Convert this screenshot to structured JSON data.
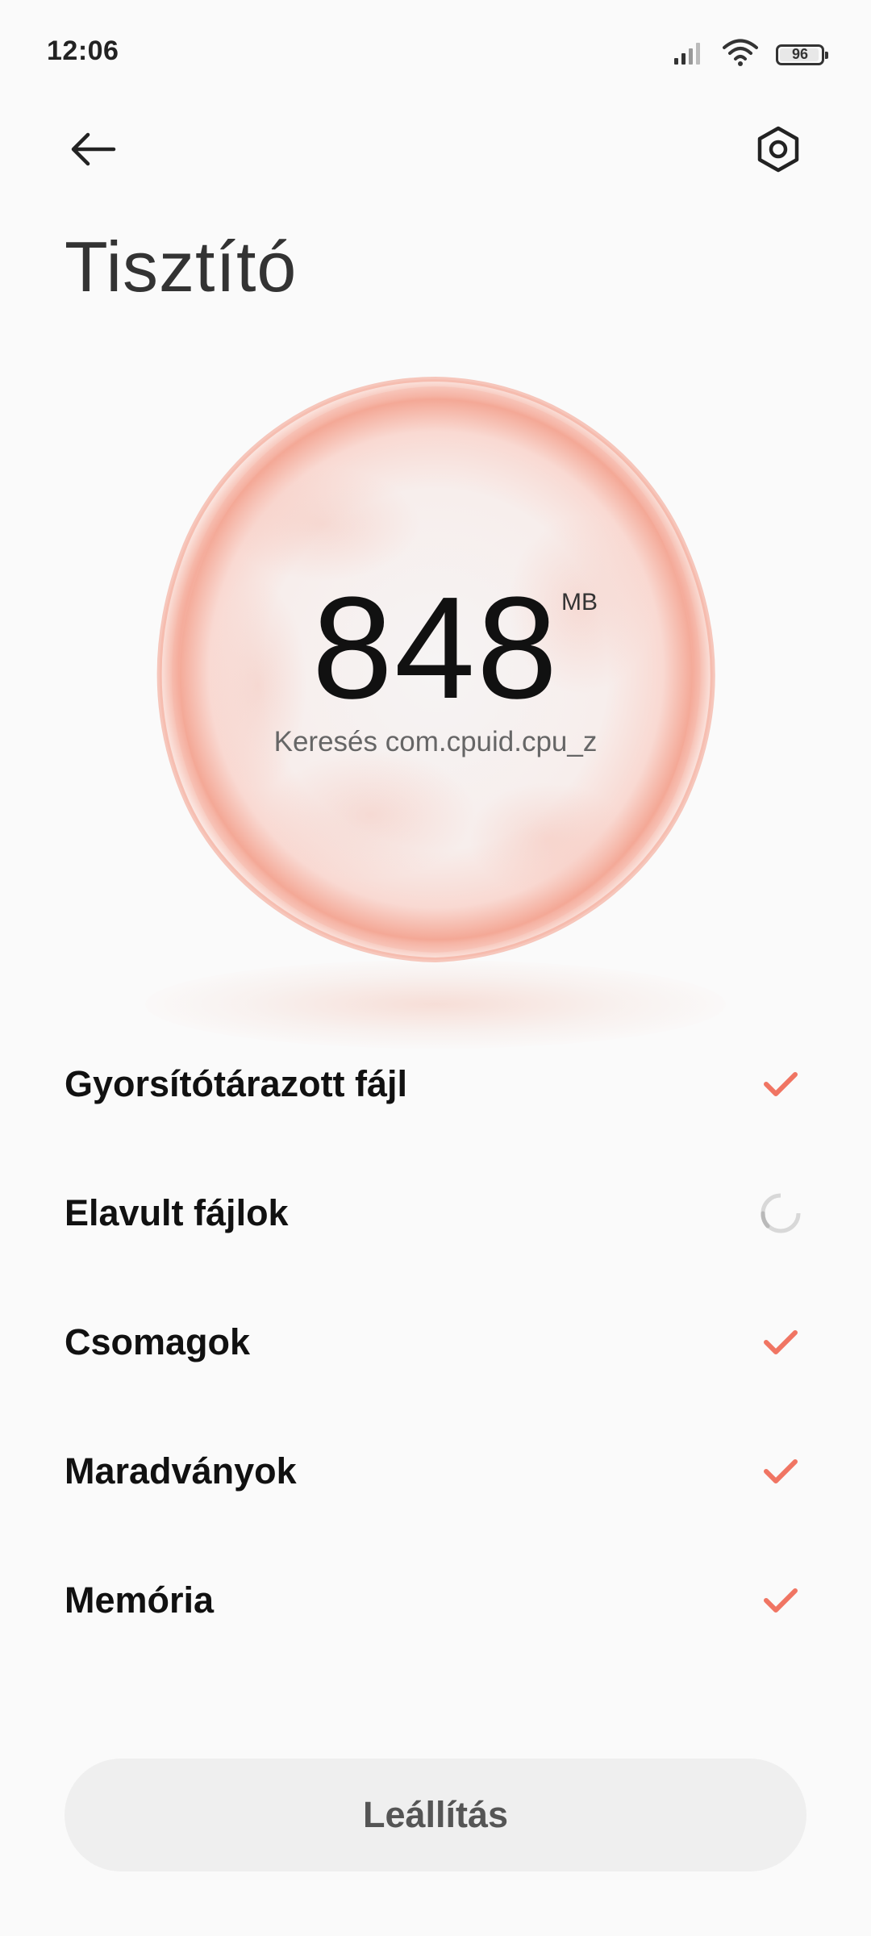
{
  "status_bar": {
    "time": "12:06",
    "battery_level": "96",
    "icons": [
      "signal-icon",
      "wifi-icon",
      "battery-icon"
    ]
  },
  "header": {
    "back_icon": "arrow-left-icon",
    "settings_icon": "gear-icon",
    "title": "Tisztító"
  },
  "scan": {
    "value": "848",
    "unit": "MB",
    "status_text": "Keresés com.cpuid.cpu_z"
  },
  "checklist": [
    {
      "label": "Gyorsítótárazott fájl",
      "state": "done"
    },
    {
      "label": "Elavult fájlok",
      "state": "scanning"
    },
    {
      "label": "Csomagok",
      "state": "done"
    },
    {
      "label": "Maradványok",
      "state": "done"
    },
    {
      "label": "Memória",
      "state": "done"
    }
  ],
  "footer": {
    "stop_label": "Leállítás"
  },
  "colors": {
    "accent": "#f07563",
    "orb": "#f4a08f",
    "spinner": "#c8c8c8"
  }
}
